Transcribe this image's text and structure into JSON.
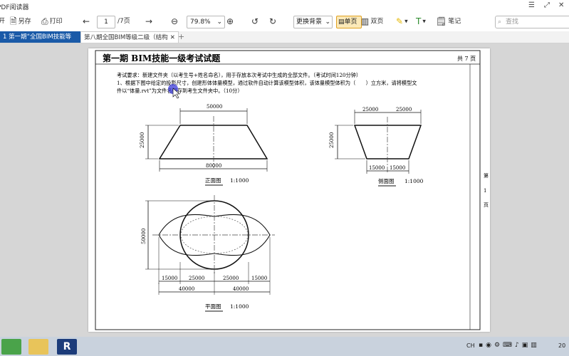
{
  "window": {
    "title": "PDF阅读器"
  },
  "toolbar": {
    "open": "开",
    "saveas": "另存",
    "print": "打印",
    "page_current": "1",
    "page_total": "/7页",
    "zoom": "79.8%",
    "background": "更换背景",
    "single_page": "单页",
    "double_page": "双页",
    "note": "笔记",
    "search_placeholder": "查找"
  },
  "tabs": [
    {
      "label": "1 第一期“全国BIM技能等"
    },
    {
      "label": "第八期全国BIM等级二级（结构"
    }
  ],
  "document": {
    "title": "第一期 BIM技能一级考试试题",
    "page_label": "共 7 页",
    "instruction": "考试要求：新建文件夹（以考生号+姓名命名），用于存放本次考试中生成的全部文件。（考试时间120分钟）",
    "question_line1": "1、根据下图中给定的投影尺寸，创建形体体量模型，通过软件自动计算该模型体积，该体量模型体积为（　　）立方米，请将模型文",
    "question_line2": "件以“体量.rvt”为文件名保存到考生文件夹中。（10分）",
    "side_label": [
      "第",
      "1",
      "页"
    ],
    "front_view": {
      "top": "50000",
      "bottom": "80000",
      "height": "25000",
      "caption": "正面图",
      "scale": "1:1000"
    },
    "side_view": {
      "top_left": "25000",
      "top_right": "25000",
      "bottom_left": "15000",
      "bottom_right": "15000",
      "height": "25000",
      "caption": "侧面图",
      "scale": "1:1000"
    },
    "plan_view": {
      "height": "50000",
      "d1": "15000",
      "d2": "25000",
      "d3": "25000",
      "d4": "15000",
      "t1": "40000",
      "t2": "40000",
      "caption": "平面图",
      "scale": "1:1000"
    }
  },
  "taskbar": {
    "lang": "CH",
    "clock": "20"
  }
}
